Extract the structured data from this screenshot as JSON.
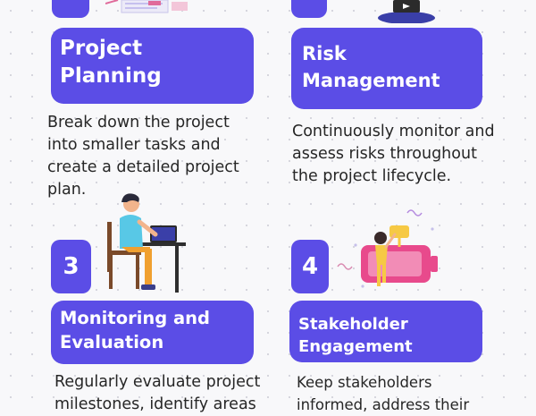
{
  "sections": [
    {
      "title_lines": [
        "Project",
        "Planning"
      ],
      "description_lines": [
        "Break down the project",
        "into smaller tasks and",
        "create a detailed project",
        "plan."
      ]
    },
    {
      "title_lines": [
        "Risk",
        "Management"
      ],
      "description_lines": [
        "Continuously monitor and",
        "assess risks throughout",
        "the project lifecycle."
      ]
    },
    {
      "number": "3",
      "title_lines": [
        "Monitoring and",
        "Evaluation"
      ],
      "description_lines": [
        "Regularly evaluate project",
        "milestones, identify areas"
      ]
    },
    {
      "number": "4",
      "title_lines": [
        "Stakeholder",
        "Engagement"
      ],
      "description_lines": [
        "Keep stakeholders",
        "informed, address their"
      ]
    }
  ],
  "colors": {
    "accent": "#5b4de6",
    "text": "#262626",
    "background": "#f8f8fa"
  },
  "illustrations": [
    "planning-documents-illustration",
    "laptop-person-illustration",
    "person-at-desk-illustration",
    "person-climbing-battery-illustration"
  ]
}
